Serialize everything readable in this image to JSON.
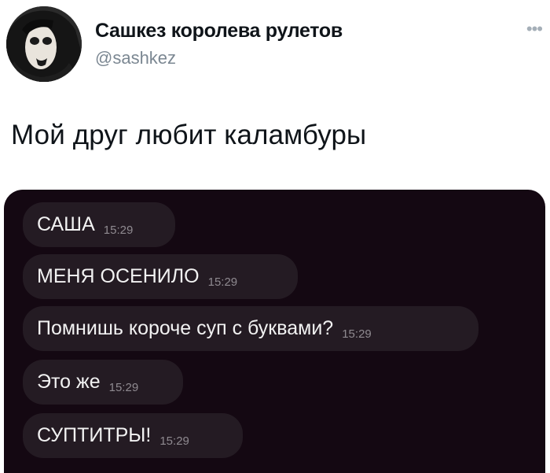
{
  "author": {
    "name": "Сашкез королева рулетов",
    "handle": "@sashkez"
  },
  "tweet": {
    "text": "Мой друг любит каламбуры"
  },
  "chat": {
    "messages": [
      {
        "text": "САША",
        "time": "15:29"
      },
      {
        "text": "МЕНЯ ОСЕНИЛО",
        "time": "15:29"
      },
      {
        "text": "Помнишь короче суп с буквами?",
        "time": "15:29"
      },
      {
        "text": "Это же",
        "time": "15:29"
      },
      {
        "text": "СУПТИТРЫ!",
        "time": "15:29"
      }
    ]
  },
  "icons": {
    "more": "more-dots-icon"
  },
  "colors": {
    "chat_background": "#140812",
    "bubble": "#241b23",
    "handle": "#7b8792"
  }
}
